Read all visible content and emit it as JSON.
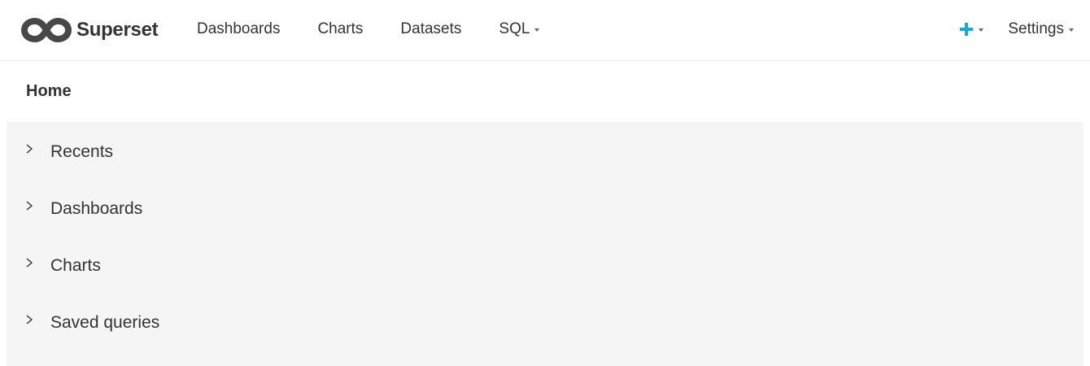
{
  "brand": {
    "name": "Superset",
    "logo_icon": "superset-infinity-logo"
  },
  "nav": {
    "items": [
      {
        "label": "Dashboards"
      },
      {
        "label": "Charts"
      },
      {
        "label": "Datasets"
      },
      {
        "label": "SQL",
        "dropdown": true
      }
    ],
    "plus_icon": "plus-icon",
    "settings_label": "Settings"
  },
  "page": {
    "title": "Home"
  },
  "sections": [
    {
      "label": "Recents",
      "icon": "chevron-right-icon"
    },
    {
      "label": "Dashboards",
      "icon": "chevron-right-icon"
    },
    {
      "label": "Charts",
      "icon": "chevron-right-icon"
    },
    {
      "label": "Saved queries",
      "icon": "chevron-right-icon"
    }
  ],
  "colors": {
    "accent": "#20a7c9",
    "text": "#333333",
    "panel_bg": "#f5f5f5"
  }
}
